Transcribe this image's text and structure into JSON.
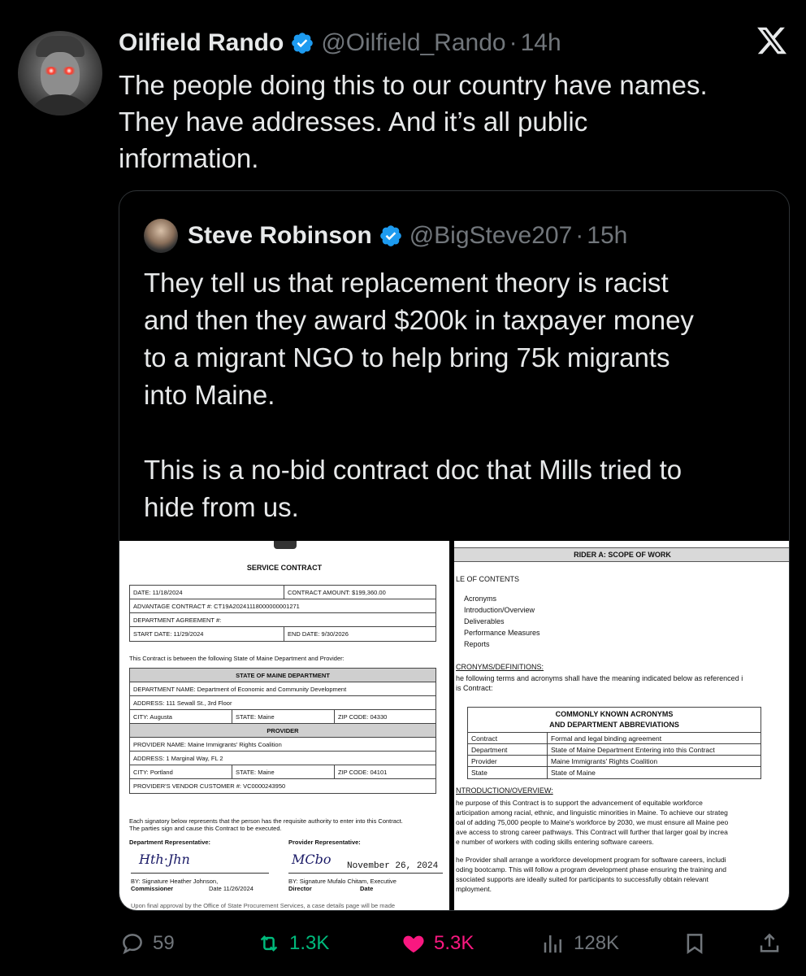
{
  "tweet": {
    "author_name": "Oilfield Rando",
    "author_handle": "@Oilfield_Rando",
    "time_sep": "·",
    "time": "14h",
    "text_lines": [
      "The people doing this to our country have names.",
      "They have addresses. And it’s all public",
      "information."
    ]
  },
  "quote": {
    "author_name": "Steve Robinson",
    "author_handle": "@BigSteve207",
    "time": "15h",
    "para1_lines": [
      "They tell us that replacement theory is racist",
      "and then they award $200k in taxpayer money",
      "to a migrant NGO to help bring 75k migrants",
      "into Maine."
    ],
    "para2_lines": [
      "This is a no-bid contract doc that Mills tried to",
      "hide from us."
    ]
  },
  "doc1": {
    "title": "SERVICE CONTRACT",
    "date": "DATE: 11/18/2024",
    "amount": "CONTRACT AMOUNT: $199,360.00",
    "advantage": "ADVANTAGE CONTRACT #:  CT19A20241118000000001271",
    "dept_agreement": "DEPARTMENT AGREEMENT #:",
    "start": "START DATE: 11/29/2024",
    "end": "END DATE: 9/30/2026",
    "between": "This Contract is between the following State of Maine Department and Provider:",
    "state_header": "STATE OF MAINE DEPARTMENT",
    "dept_name": "DEPARTMENT NAME: Department of Economic and Community Development",
    "dept_address": "ADDRESS: 111 Sewall St., 3rd Floor",
    "dept_city": "CITY: Augusta",
    "dept_state": "STATE: Maine",
    "dept_zip": "ZIP CODE: 04330",
    "provider_header": "PROVIDER",
    "prov_name": "PROVIDER NAME: Maine Immigrants' Rights Coalition",
    "prov_address": "ADDRESS: 1 Marginal Way, FL 2",
    "prov_city": "CITY: Portland",
    "prov_state": "STATE: Maine",
    "prov_zip": "ZIP CODE: 04101",
    "vendor": "PROVIDER'S VENDOR CUSTOMER #: VC0000243950",
    "sign_note1": "Each signatory below represents that the person has the requisite authority to enter into this Contract.",
    "sign_note2": "The parties sign and cause this Contract to be executed.",
    "dept_rep": "Department Representative:",
    "prov_rep": "Provider Representative:",
    "handwritten_date": "November 26, 2024",
    "dept_sig1": "BY: Signature Heather Johnson,",
    "dept_sig2": "Commissioner",
    "dept_date": "Date 11/26/2024",
    "prov_sig1": "BY: Signature Mufalo Chitam, Executive",
    "prov_sig2": "Director",
    "prov_date": "Date",
    "footer_cut": "Upon final approval by the Office of State Procurement Services, a case details page will be made"
  },
  "doc2": {
    "banner": "RIDER A: SCOPE OF WORK",
    "toc": "LE OF CONTENTS",
    "toc_items": [
      "Acronyms",
      "Introduction/Overview",
      "Deliverables",
      "Performance Measures",
      "Reports"
    ],
    "acr_heading": "CRONYMS/DEFINITIONS:",
    "acr_intro1": "he following terms and acronyms shall have the meaning indicated below as referenced i",
    "acr_intro2": "is Contract:",
    "table_title1": "COMMONLY KNOWN ACRONYMS",
    "table_title2": "AND DEPARTMENT ABBREVIATIONS",
    "rows": [
      {
        "k": "Contract",
        "v": "Formal and legal binding agreement"
      },
      {
        "k": "Department",
        "v": "State of Maine Department Entering into this Contract"
      },
      {
        "k": "Provider",
        "v": "Maine Immigrants' Rights Coalition"
      },
      {
        "k": "State",
        "v": "State of Maine"
      }
    ],
    "intro_heading": "NTRODUCTION/OVERVIEW:",
    "intro_lines": [
      "he purpose of this Contract is to support the advancement of equitable workforce",
      "articipation among racial, ethnic, and linguistic minorities in Maine. To achieve our strateg",
      "oal of adding 75,000 people to Maine's workforce by 2030, we must ensure all Maine peo",
      "ave access to strong career pathways. This Contract will further that larger goal by increa",
      "e number of workers with coding skills entering software careers."
    ],
    "provider_lines": [
      "he Provider shall arrange a workforce development program for software careers, includi",
      "oding bootcamp. This will follow a program development phase ensuring the training and",
      "ssociated supports are ideally suited for participants to successfully obtain relevant",
      "mployment."
    ]
  },
  "actions": {
    "replies": "59",
    "reposts": "1.3K",
    "likes": "5.3K",
    "views": "128K"
  },
  "colors": {
    "background": "#000000",
    "text": "#e7e9ea",
    "muted": "#71767b",
    "verified": "#1d9bf0",
    "repost": "#00ba7c",
    "like": "#f91880"
  }
}
